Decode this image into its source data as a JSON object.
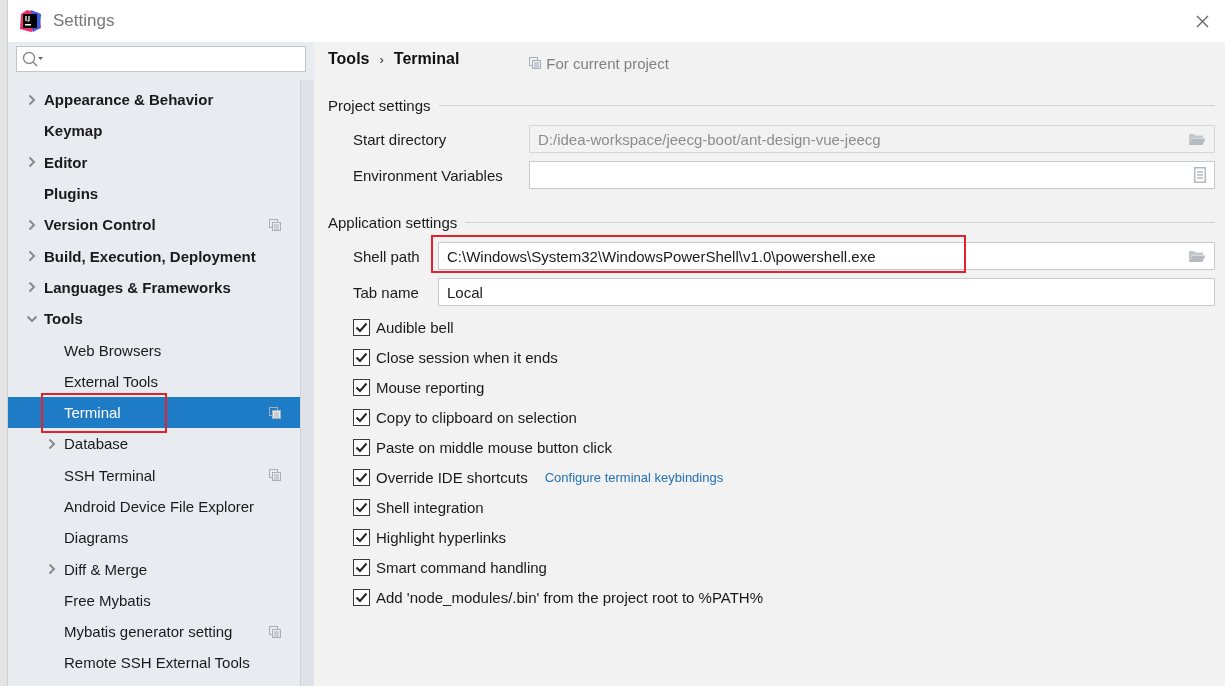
{
  "window": {
    "title": "Settings"
  },
  "sidebar": {
    "items": [
      {
        "label": "Appearance & Behavior",
        "expanded": false,
        "selected": false
      },
      {
        "label": "Keymap",
        "selected": false
      },
      {
        "label": "Editor",
        "expanded": false,
        "selected": false
      },
      {
        "label": "Plugins",
        "selected": false
      },
      {
        "label": "Version Control",
        "expanded": false,
        "selected": false,
        "project_scoped": true
      },
      {
        "label": "Build, Execution, Deployment",
        "expanded": false,
        "selected": false
      },
      {
        "label": "Languages & Frameworks",
        "expanded": false,
        "selected": false
      },
      {
        "label": "Tools",
        "expanded": true,
        "selected": false,
        "children": [
          {
            "label": "Web Browsers",
            "selected": false
          },
          {
            "label": "External Tools",
            "selected": false
          },
          {
            "label": "Terminal",
            "selected": true,
            "annotated": true,
            "project_scoped": true
          },
          {
            "label": "Database",
            "expanded": false,
            "selected": false
          },
          {
            "label": "SSH Terminal",
            "selected": false,
            "project_scoped": true
          },
          {
            "label": "Android Device File Explorer",
            "selected": false
          },
          {
            "label": "Diagrams",
            "selected": false
          },
          {
            "label": "Diff & Merge",
            "expanded": false,
            "selected": false
          },
          {
            "label": "Free Mybatis",
            "selected": false
          },
          {
            "label": "Mybatis generator setting",
            "selected": false,
            "project_scoped": true
          },
          {
            "label": "Remote SSH External Tools",
            "selected": false
          }
        ]
      }
    ]
  },
  "breadcrumb": [
    {
      "text": "Tools",
      "kind": "item"
    },
    {
      "text": "›",
      "kind": "separator"
    },
    {
      "text": "Terminal",
      "kind": "item"
    }
  ],
  "scope_note": "For current project",
  "sections": [
    {
      "title": "Project settings",
      "fields": [
        {
          "label": "Start directory",
          "value": "D:/idea-workspace/jeecg-boot/ant-design-vue-jeecg",
          "kind": "folder",
          "disabled": true
        },
        {
          "label": "Environment Variables",
          "kind": "list",
          "disabled": false
        }
      ]
    },
    {
      "title": "Application settings",
      "fields": [
        {
          "label": "Shell path",
          "value": "C:\\Windows\\System32\\WindowsPowerShell\\v1.0\\powershell.exe",
          "kind": "folder",
          "disabled": false,
          "annotated": true
        },
        {
          "label": "Tab name",
          "value": "Local",
          "kind": "plain",
          "disabled": false
        }
      ]
    }
  ],
  "options": [
    {
      "label": "Audible bell",
      "checked": true
    },
    {
      "label": "Close session when it ends",
      "checked": true
    },
    {
      "label": "Mouse reporting",
      "checked": true
    },
    {
      "label": "Copy to clipboard on selection",
      "checked": true
    },
    {
      "label": "Paste on middle mouse button click",
      "checked": true
    },
    {
      "label": "Override IDE shortcuts",
      "checked": true,
      "link": "Configure terminal keybindings"
    },
    {
      "label": "Shell integration",
      "checked": true
    },
    {
      "label": "Highlight hyperlinks",
      "checked": true
    },
    {
      "label": "Smart command handling",
      "checked": true
    },
    {
      "label": "Add 'node_modules/.bin' from the project root to %PATH%",
      "checked": true
    }
  ]
}
